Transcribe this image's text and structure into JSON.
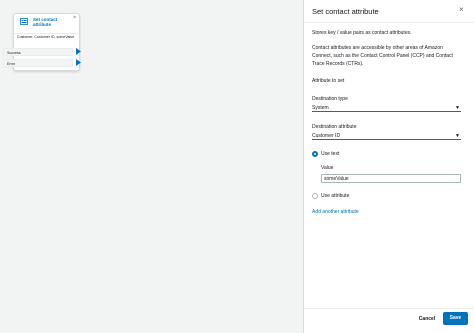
{
  "flow_block": {
    "title": "Set contact attribute",
    "close": "×",
    "body": "Customer, Customer ID, someValue",
    "branches": [
      "Success",
      "Error"
    ]
  },
  "panel": {
    "title": "Set contact attribute",
    "close": "×",
    "description": "Stores key / value pairs as contact attributes.",
    "info": "Contact attributes are accessible by other areas of Amazon Connect, such as the Contact Control Panel (CCP) and Contact Trace Records (CTRs).",
    "attribute_to_set": "Attribute to set",
    "destination_type_label": "Destination type",
    "destination_type_value": "System",
    "destination_attribute_label": "Destination attribute",
    "destination_attribute_value": "Customer ID",
    "use_text_label": "Use text",
    "value_label": "Value",
    "value_input": "someValue",
    "use_attribute_label": "Use attribute",
    "add_another": "Add another attribute",
    "cancel": "Cancel",
    "save": "Save"
  }
}
